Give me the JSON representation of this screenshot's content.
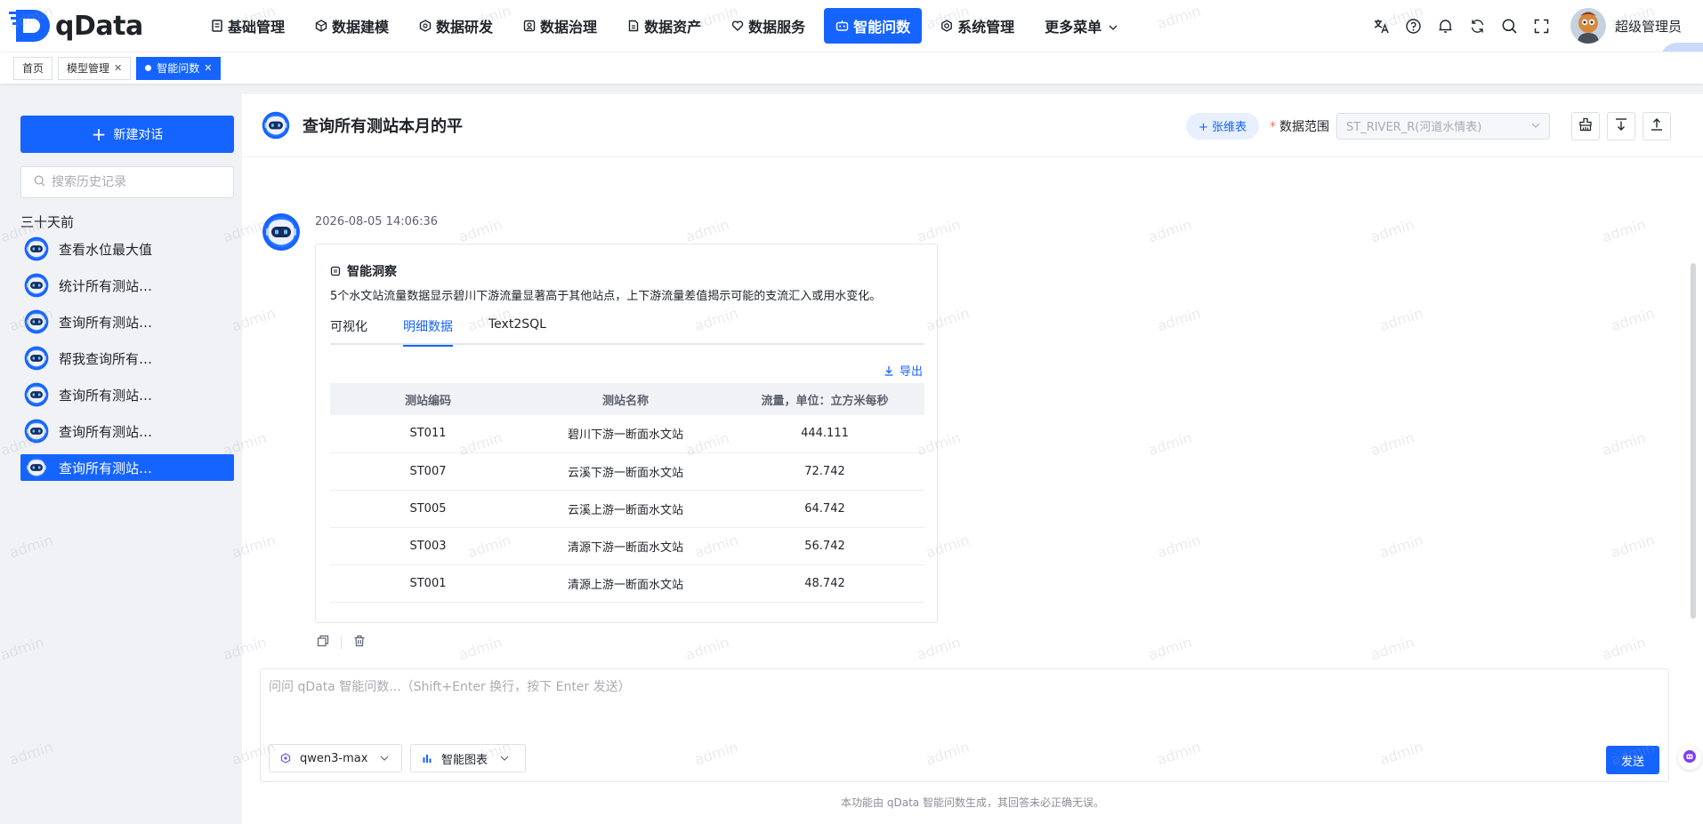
{
  "app": {
    "logo_text": "qData"
  },
  "nav": {
    "items": [
      {
        "label": "基础管理",
        "icon": "file-icon"
      },
      {
        "label": "数据建模",
        "icon": "cube-icon"
      },
      {
        "label": "数据研发",
        "icon": "hexagon-icon"
      },
      {
        "label": "数据治理",
        "icon": "shield-icon"
      },
      {
        "label": "数据资产",
        "icon": "document-icon"
      },
      {
        "label": "数据服务",
        "icon": "heart-icon"
      },
      {
        "label": "智能问数",
        "icon": "robot-icon",
        "active": true
      },
      {
        "label": "系统管理",
        "icon": "gear-icon"
      },
      {
        "label": "更多菜单",
        "icon": "chevron-down-icon"
      }
    ],
    "user_name": "超级管理员",
    "translate_label": "译"
  },
  "tabs": [
    {
      "label": "首页"
    },
    {
      "label": "模型管理"
    },
    {
      "label": "智能问数",
      "active": true
    }
  ],
  "sidebar": {
    "new_chat_label": "新建对话",
    "search_placeholder": "搜索历史记录",
    "group_label": "三十天前",
    "history": [
      {
        "label": "查看水位最大值"
      },
      {
        "label": "统计所有测站…"
      },
      {
        "label": "查询所有测站…"
      },
      {
        "label": "帮我查询所有…"
      },
      {
        "label": "查询所有测站…"
      },
      {
        "label": "查询所有测站…"
      },
      {
        "label": "查询所有测站…",
        "active": true
      }
    ]
  },
  "header": {
    "title": "查询所有测站本月的平",
    "table_pill": "+ 张维表",
    "scope_label": "数据范围",
    "scope_value": "ST_RIVER_R(河道水情表)"
  },
  "message": {
    "timestamp": "2026-08-05 14:06:36",
    "insight_title": "智能洞察",
    "insight_text": "5个水文站流量数据显示碧川下游流量显著高于其他站点，上下游流量差值揭示可能的支流汇入或用水变化。",
    "tabs": [
      "可视化",
      "明细数据",
      "Text2SQL"
    ],
    "active_tab_index": 1,
    "export_label": "导出",
    "table": {
      "columns": [
        "测站编码",
        "测站名称",
        "流量，单位：立方米每秒"
      ],
      "rows": [
        [
          "ST011",
          "碧川下游一断面水文站",
          "444.111"
        ],
        [
          "ST007",
          "云溪下游一断面水文站",
          "72.742"
        ],
        [
          "ST005",
          "云溪上游一断面水文站",
          "64.742"
        ],
        [
          "ST003",
          "清源下游一断面水文站",
          "56.742"
        ],
        [
          "ST001",
          "清源上游一断面水文站",
          "48.742"
        ]
      ]
    }
  },
  "composer": {
    "placeholder": "问问 qData 智能问数...（Shift+Enter 换行，按下 Enter 发送）",
    "model_value": "qwen3-max",
    "mode_value": "智能图表",
    "send_label": "发送"
  },
  "disclaimer": "本功能由 qData 智能问数生成，其回答未必正确无误。",
  "watermark_text": "admin",
  "colors": {
    "accent": "#1664ff",
    "required": "#f56c6c"
  }
}
